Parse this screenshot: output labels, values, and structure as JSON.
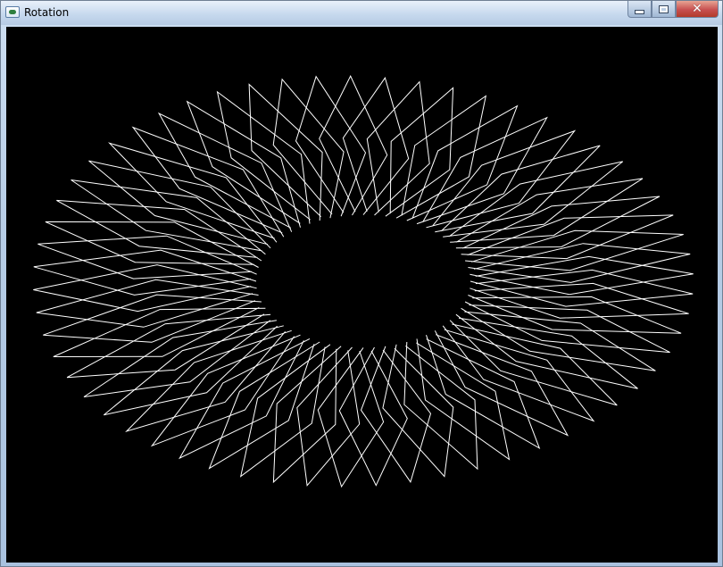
{
  "window": {
    "title": "Rotation",
    "controls": {
      "minimize": "minimize",
      "maximize": "maximize",
      "close": "✕"
    }
  },
  "scene": {
    "background_color": "#000000",
    "line_color": "#ffffff",
    "description_icon": "app-window-icon",
    "blade_count": 60
  }
}
